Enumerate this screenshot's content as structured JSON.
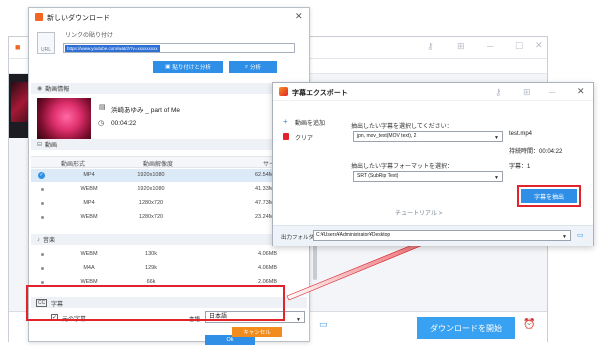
{
  "main_window": {
    "download_button_label": "ダウンロードを開始"
  },
  "download_dialog": {
    "title": "新しいダウンロード",
    "link_label": "リンクの貼り付け",
    "link_value": "https://www.youtube.com/watch?v=xxxxxxxxx",
    "paste_analyze_label": "貼り付けと分析",
    "analyze_label": "分析",
    "video_info_label": "動画情報",
    "video_name": "浜崎あゆみ _ part of Me",
    "video_duration": "00:04:22",
    "video_section_label": "動画",
    "table_headers": [
      "動画形式",
      "動画解像度",
      "サイズ"
    ],
    "video_rows": [
      {
        "format": "MP4",
        "resolution": "1920x1080",
        "size": "62.54MB",
        "selected": true
      },
      {
        "format": "WEBM",
        "resolution": "1920x1080",
        "size": "41.33MB",
        "selected": false
      },
      {
        "format": "MP4",
        "resolution": "1280x720",
        "size": "47.73MB",
        "selected": false
      },
      {
        "format": "WEBM",
        "resolution": "1280x720",
        "size": "23.24MB",
        "selected": false
      }
    ],
    "audio_section_label": "音楽",
    "audio_rows": [
      {
        "format": "WEBM",
        "bitrate": "130k",
        "size": "4.06MB"
      },
      {
        "format": "M4A",
        "bitrate": "129k",
        "size": "4.06MB"
      },
      {
        "format": "WEBM",
        "bitrate": "66k",
        "size": "2.06MB"
      }
    ],
    "subtitle_section_label": "字幕",
    "original_subtitle_label": "元の字幕",
    "language_label": "言語",
    "language_value": "日本語",
    "ok_label": "Ok",
    "cancel_label": "キャンセル"
  },
  "subtitle_export": {
    "title": "字幕エクスポート",
    "add_video_label": "動画を追加",
    "clear_label": "クリア",
    "select_track_label": "抽出したい字幕を選択してください：",
    "track_value": "jpn, mov_text(MOV text), 2",
    "select_format_label": "抽出したい字幕フォーマットを選択：",
    "format_value": "SRT (SubRip Text)",
    "tutorial_label": "チュートリアル >",
    "file_name": "test.mp4",
    "duration_text": "持続時間：00:04:22",
    "subtitle_count_text": "字幕：1",
    "extract_label": "字幕を抽出",
    "output_folder_label": "出力フォルダ：",
    "output_path": "C:¥Users¥Administrator¥Desktop"
  },
  "colors": {
    "accent": "#2f8fe6",
    "highlight_red": "#e2222c",
    "cancel_orange": "#f28c1e"
  }
}
